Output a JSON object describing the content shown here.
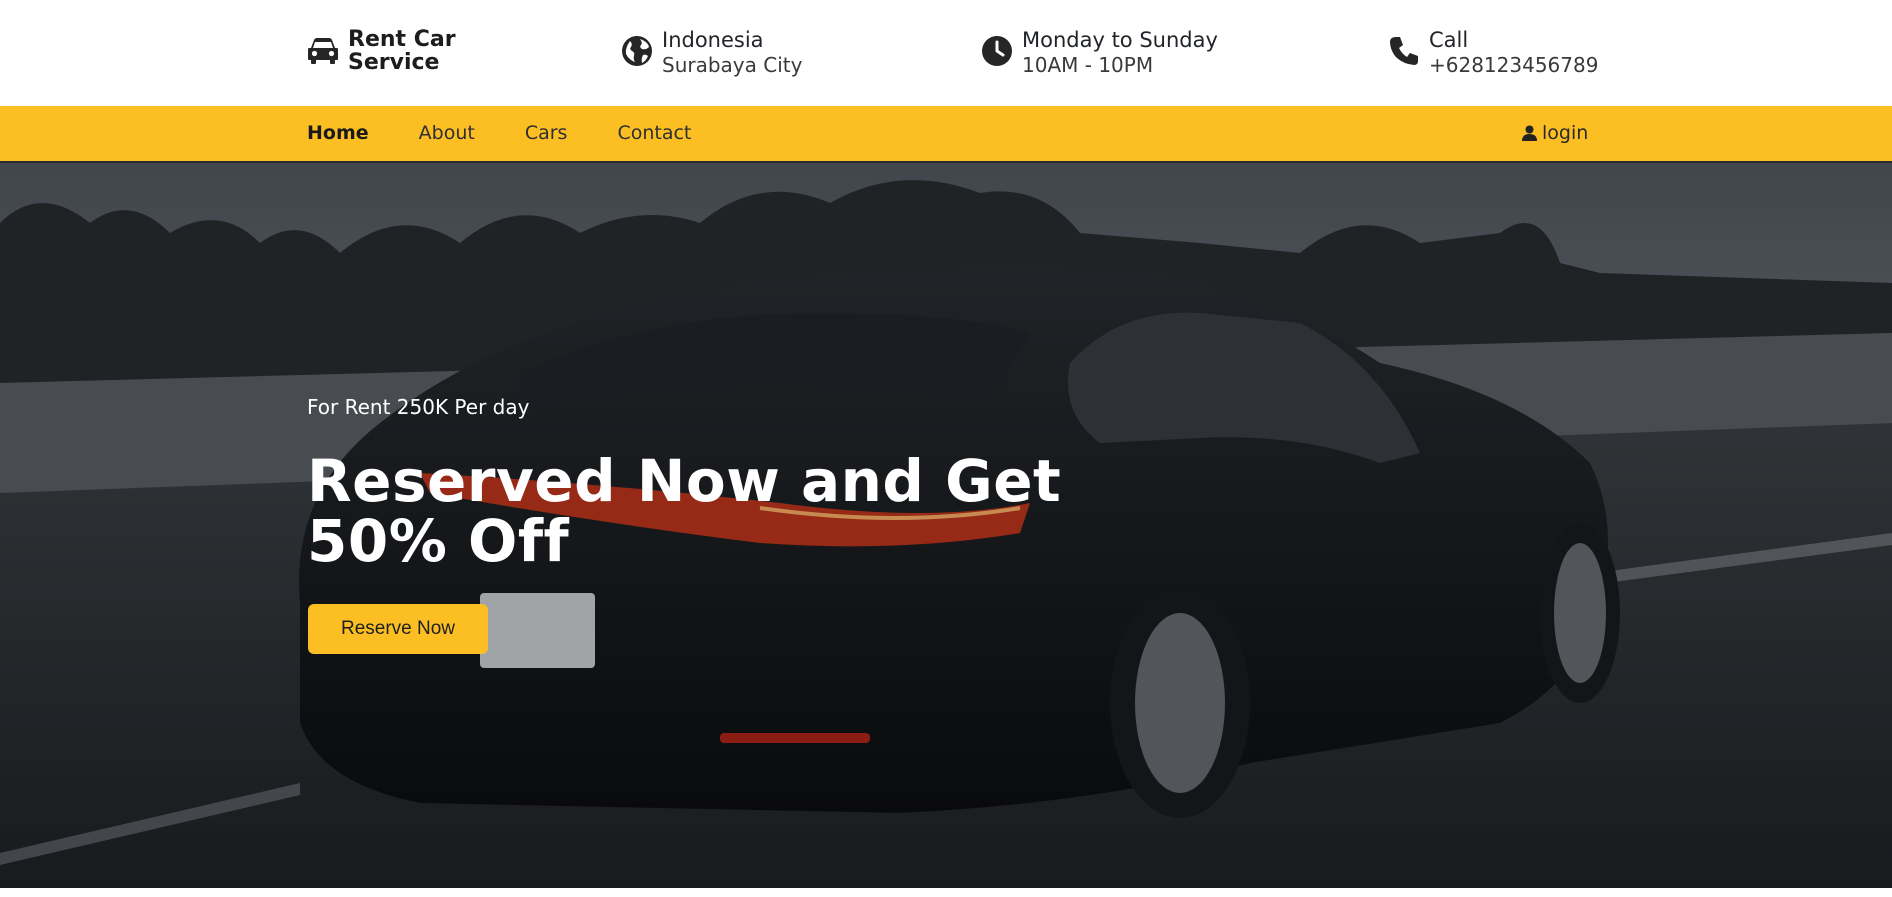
{
  "topbar": {
    "brand": {
      "name": "Rent Car Service",
      "icon": "car-icon"
    },
    "location": {
      "title": "Indonesia",
      "detail": "Surabaya City",
      "icon": "globe-icon"
    },
    "hours": {
      "title": "Monday to Sunday",
      "detail": "10AM - 10PM",
      "icon": "clock-icon"
    },
    "call": {
      "title": "Call",
      "detail": "+628123456789",
      "icon": "phone-icon"
    }
  },
  "nav": {
    "links": [
      {
        "label": "Home",
        "active": true
      },
      {
        "label": "About",
        "active": false
      },
      {
        "label": "Cars",
        "active": false
      },
      {
        "label": "Contact",
        "active": false
      }
    ],
    "login": {
      "label": "login",
      "icon": "user-icon"
    }
  },
  "hero": {
    "subtitle": "For Rent 250K Per day",
    "headline": "Reserved Now and Get 50% Off",
    "button": "Reserve Now"
  },
  "colors": {
    "accent": "#fbbf24",
    "text": "#212529",
    "hero_text": "#ffffff"
  }
}
